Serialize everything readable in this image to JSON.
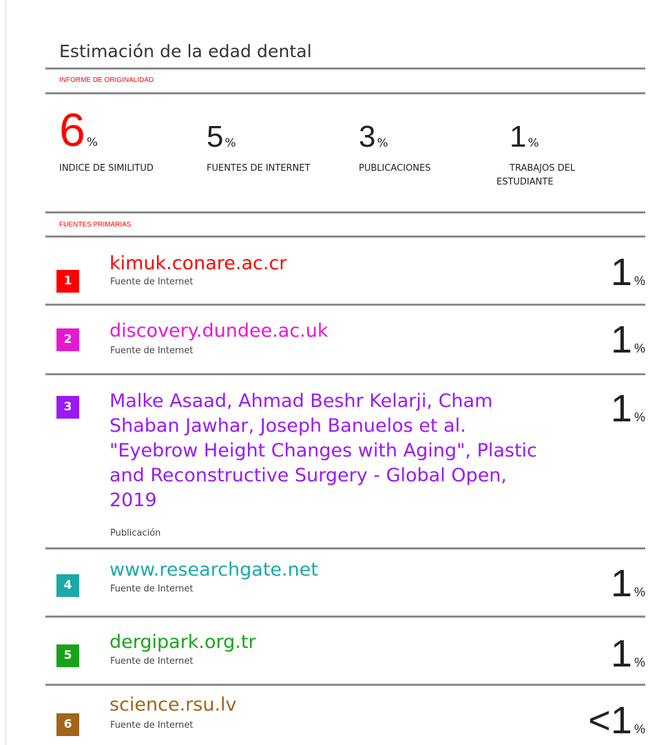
{
  "title": "Estimación de la edad dental",
  "originality_label": "INFORME DE ORIGINALIDAD",
  "stats": [
    {
      "value": "6",
      "unit": "%",
      "label": "INDICE DE SIMILITUD",
      "color": "#ff0000"
    },
    {
      "value": "5",
      "unit": "%",
      "label": "FUENTES DE INTERNET",
      "color": "#222222"
    },
    {
      "value": "3",
      "unit": "%",
      "label": "PUBLICACIONES",
      "color": "#222222"
    },
    {
      "value": "1",
      "unit": "%",
      "label_line1": "TRABAJOS DEL",
      "label_line2": "ESTUDIANTE",
      "color": "#222222"
    }
  ],
  "primary_sources_label": "FUENTES PRIMARIAS",
  "sources": [
    {
      "num": "1",
      "title": "kimuk.conare.ac.cr",
      "type": "Fuente de Internet",
      "pct": "1",
      "pct_unit": "%",
      "color": "#ff0000"
    },
    {
      "num": "2",
      "title": "discovery.dundee.ac.uk",
      "type": "Fuente de Internet",
      "pct": "1",
      "pct_unit": "%",
      "color": "#e619d2"
    },
    {
      "num": "3",
      "title": "Malke Asaad, Ahmad Beshr Kelarji, Cham Shaban Jawhar, Joseph Banuelos et al. \"Eyebrow Height Changes with Aging\", Plastic and Reconstructive Surgery - Global Open, 2019",
      "type": "Publicación",
      "pct": "1",
      "pct_unit": "%",
      "color": "#9b19f5"
    },
    {
      "num": "4",
      "title": "www.researchgate.net",
      "type": "Fuente de Internet",
      "pct": "1",
      "pct_unit": "%",
      "color": "#1ca8a8"
    },
    {
      "num": "5",
      "title": "dergipark.org.tr",
      "type": "Fuente de Internet",
      "pct": "1",
      "pct_unit": "%",
      "color": "#19a319"
    },
    {
      "num": "6",
      "title": "science.rsu.lv",
      "type": "Fuente de Internet",
      "pct": "<1",
      "pct_unit": "%",
      "color": "#a0661a"
    }
  ]
}
